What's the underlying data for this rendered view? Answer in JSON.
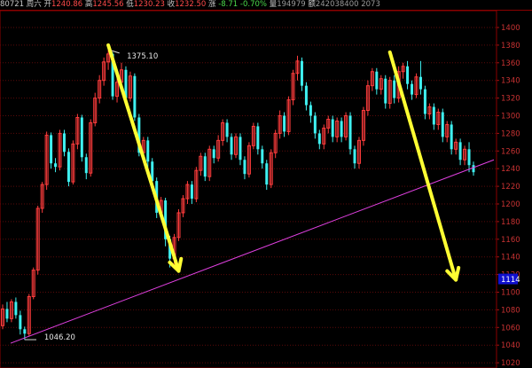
{
  "header": {
    "date": "80721",
    "weekday": "周六",
    "open_label": "开",
    "open": "1240.86",
    "high_label": "高",
    "high": "1245.56",
    "low_label": "低",
    "low": "1230.23",
    "close_label": "收",
    "close": "1232.50",
    "change_label": "涨",
    "change": "-8.71",
    "change_pct": "-0.70%",
    "volume_label": "量",
    "volume": "194979",
    "amount_label": "额",
    "amount": "242038400",
    "count": "2073"
  },
  "chart_data": {
    "type": "candlestick",
    "y_ticks": [
      "1400",
      "1380",
      "1360",
      "1340",
      "1320",
      "1300",
      "1280",
      "1260",
      "1240",
      "1220",
      "1200",
      "1180",
      "1160",
      "1140",
      "1120",
      "1100",
      "1080",
      "1060",
      "1040",
      "1020"
    ],
    "ylim": [
      1014,
      1410
    ],
    "grid": true,
    "annotations": {
      "high_label": "1375.10",
      "low_label": "1046.20",
      "price_box": "1114"
    },
    "support_line": {
      "start": [
        0,
        1046.2
      ],
      "end": [
        109,
        1250
      ]
    },
    "arrows": [
      {
        "from": [
          24,
          1378
        ],
        "to": [
          40,
          1128
        ]
      },
      {
        "from": [
          87,
          1372
        ],
        "to": [
          100,
          1130
        ]
      },
      {
        "from": [
          91,
          1335
        ],
        "to": [
          99,
          1138
        ]
      }
    ],
    "candles": [
      [
        1062,
        1081,
        1058,
        1086
      ],
      [
        1081,
        1070,
        1066,
        1089
      ],
      [
        1070,
        1089,
        1066,
        1092
      ],
      [
        1089,
        1074,
        1070,
        1094
      ],
      [
        1074,
        1058,
        1052,
        1079
      ],
      [
        1058,
        1053,
        1046,
        1061
      ],
      [
        1053,
        1095,
        1050,
        1098
      ],
      [
        1095,
        1125,
        1092,
        1128
      ],
      [
        1125,
        1195,
        1120,
        1198
      ],
      [
        1195,
        1222,
        1190,
        1225
      ],
      [
        1222,
        1278,
        1216,
        1282
      ],
      [
        1278,
        1246,
        1240,
        1281
      ],
      [
        1246,
        1242,
        1236,
        1252
      ],
      [
        1242,
        1280,
        1238,
        1284
      ],
      [
        1280,
        1259,
        1254,
        1284
      ],
      [
        1259,
        1225,
        1220,
        1263
      ],
      [
        1225,
        1268,
        1222,
        1272
      ],
      [
        1268,
        1298,
        1262,
        1302
      ],
      [
        1298,
        1253,
        1248,
        1301
      ],
      [
        1253,
        1235,
        1228,
        1257
      ],
      [
        1235,
        1292,
        1231,
        1296
      ],
      [
        1292,
        1320,
        1288,
        1326
      ],
      [
        1320,
        1340,
        1314,
        1346
      ],
      [
        1340,
        1361,
        1334,
        1366
      ],
      [
        1361,
        1370,
        1352,
        1375
      ],
      [
        1370,
        1322,
        1318,
        1372
      ],
      [
        1322,
        1338,
        1315,
        1343
      ],
      [
        1338,
        1352,
        1332,
        1360
      ],
      [
        1352,
        1320,
        1315,
        1356
      ],
      [
        1320,
        1345,
        1316,
        1350
      ],
      [
        1345,
        1298,
        1294,
        1348
      ],
      [
        1298,
        1258,
        1254,
        1302
      ],
      [
        1258,
        1272,
        1252,
        1276
      ],
      [
        1272,
        1248,
        1240,
        1276
      ],
      [
        1248,
        1226,
        1220,
        1252
      ],
      [
        1226,
        1190,
        1184,
        1230
      ],
      [
        1190,
        1204,
        1186,
        1208
      ],
      [
        1204,
        1160,
        1152,
        1207
      ],
      [
        1160,
        1138,
        1128,
        1164
      ],
      [
        1138,
        1162,
        1132,
        1166
      ],
      [
        1162,
        1190,
        1158,
        1194
      ],
      [
        1190,
        1206,
        1185,
        1210
      ],
      [
        1206,
        1222,
        1200,
        1226
      ],
      [
        1222,
        1206,
        1200,
        1226
      ],
      [
        1206,
        1238,
        1202,
        1242
      ],
      [
        1238,
        1254,
        1232,
        1258
      ],
      [
        1254,
        1231,
        1226,
        1258
      ],
      [
        1231,
        1262,
        1226,
        1266
      ],
      [
        1262,
        1252,
        1246,
        1266
      ],
      [
        1252,
        1272,
        1248,
        1278
      ],
      [
        1272,
        1292,
        1266,
        1296
      ],
      [
        1292,
        1276,
        1270,
        1296
      ],
      [
        1276,
        1256,
        1250,
        1280
      ],
      [
        1256,
        1276,
        1252,
        1280
      ],
      [
        1276,
        1250,
        1244,
        1280
      ],
      [
        1250,
        1234,
        1228,
        1254
      ],
      [
        1234,
        1266,
        1230,
        1270
      ],
      [
        1266,
        1288,
        1262,
        1292
      ],
      [
        1288,
        1262,
        1256,
        1292
      ],
      [
        1262,
        1246,
        1240,
        1266
      ],
      [
        1246,
        1222,
        1216,
        1250
      ],
      [
        1222,
        1258,
        1218,
        1262
      ],
      [
        1258,
        1280,
        1252,
        1284
      ],
      [
        1280,
        1300,
        1274,
        1306
      ],
      [
        1300,
        1282,
        1276,
        1304
      ],
      [
        1282,
        1318,
        1278,
        1322
      ],
      [
        1318,
        1348,
        1312,
        1352
      ],
      [
        1348,
        1362,
        1340,
        1368
      ],
      [
        1362,
        1334,
        1328,
        1366
      ],
      [
        1334,
        1312,
        1306,
        1338
      ],
      [
        1312,
        1300,
        1292,
        1316
      ],
      [
        1300,
        1280,
        1274,
        1304
      ],
      [
        1280,
        1268,
        1262,
        1284
      ],
      [
        1268,
        1286,
        1262,
        1290
      ],
      [
        1286,
        1296,
        1280,
        1300
      ],
      [
        1296,
        1276,
        1270,
        1300
      ],
      [
        1276,
        1294,
        1270,
        1298
      ],
      [
        1294,
        1276,
        1270,
        1298
      ],
      [
        1276,
        1300,
        1272,
        1304
      ],
      [
        1300,
        1262,
        1256,
        1304
      ],
      [
        1262,
        1246,
        1240,
        1266
      ],
      [
        1246,
        1272,
        1240,
        1276
      ],
      [
        1272,
        1306,
        1266,
        1310
      ],
      [
        1306,
        1334,
        1300,
        1340
      ],
      [
        1334,
        1350,
        1328,
        1354
      ],
      [
        1350,
        1330,
        1324,
        1354
      ],
      [
        1330,
        1342,
        1324,
        1346
      ],
      [
        1342,
        1314,
        1308,
        1346
      ],
      [
        1314,
        1340,
        1308,
        1344
      ],
      [
        1340,
        1320,
        1314,
        1346
      ],
      [
        1320,
        1350,
        1315,
        1356
      ],
      [
        1350,
        1356,
        1342,
        1360
      ],
      [
        1356,
        1336,
        1330,
        1362
      ],
      [
        1336,
        1324,
        1318,
        1340
      ],
      [
        1324,
        1344,
        1320,
        1348
      ],
      [
        1344,
        1330,
        1324,
        1362
      ],
      [
        1330,
        1302,
        1296,
        1334
      ],
      [
        1302,
        1310,
        1296,
        1314
      ],
      [
        1310,
        1290,
        1284,
        1314
      ],
      [
        1290,
        1304,
        1284,
        1308
      ],
      [
        1304,
        1276,
        1270,
        1308
      ],
      [
        1276,
        1290,
        1270,
        1294
      ],
      [
        1290,
        1262,
        1256,
        1294
      ],
      [
        1262,
        1270,
        1256,
        1274
      ],
      [
        1270,
        1250,
        1244,
        1274
      ],
      [
        1250,
        1262,
        1244,
        1266
      ],
      [
        1262,
        1244,
        1236,
        1270
      ],
      [
        1244,
        1236,
        1232,
        1248
      ]
    ]
  }
}
